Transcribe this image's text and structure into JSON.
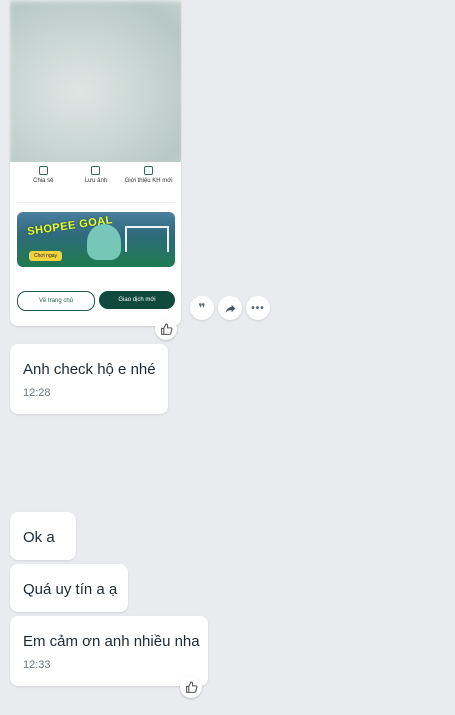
{
  "image_message": {
    "screenshot": {
      "actions": [
        "Chia sẻ",
        "Lưu ảnh",
        "Giới thiệu KH mới"
      ],
      "banner_title": "SHOPEE GOAL",
      "banner_cta": "Chơi ngay",
      "buttons": [
        "Về trang chủ",
        "Giao dịch mới"
      ]
    }
  },
  "quick_actions": [
    "quote-icon",
    "share-icon",
    "more-icon"
  ],
  "messages": [
    {
      "text": "Anh check hộ e nhé",
      "time": "12:28"
    },
    {
      "text": "Ok a",
      "time": ""
    },
    {
      "text": "Quá uy tín a ạ",
      "time": ""
    },
    {
      "text": "Em cảm ơn anh nhiều nha",
      "time": "12:33"
    }
  ],
  "colors": {
    "background": "#e9ebef",
    "bubble": "#ffffff",
    "primary_button": "#0f4a3c"
  }
}
